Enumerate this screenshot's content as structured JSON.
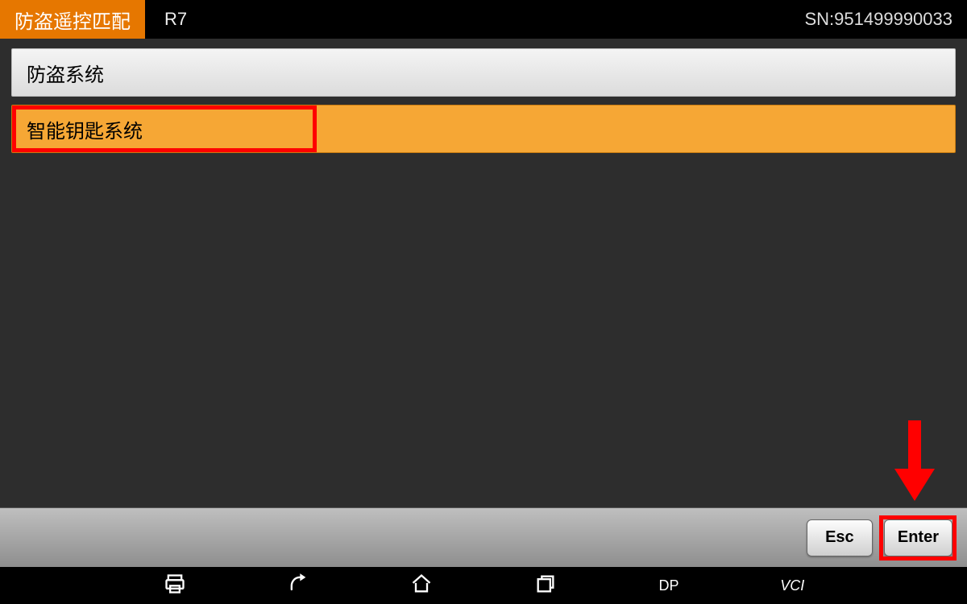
{
  "header": {
    "title": "防盗遥控匹配",
    "model": "R7",
    "serial": "SN:951499990033"
  },
  "menu": {
    "items": [
      {
        "label": "防盗系统",
        "selected": false
      },
      {
        "label": "智能钥匙系统",
        "selected": true
      }
    ]
  },
  "footer": {
    "esc_label": "Esc",
    "enter_label": "Enter"
  },
  "navbar": {
    "dp_label": "DP",
    "vci_label": "VCI"
  },
  "annotations": {
    "highlight_color": "#ff0000"
  }
}
